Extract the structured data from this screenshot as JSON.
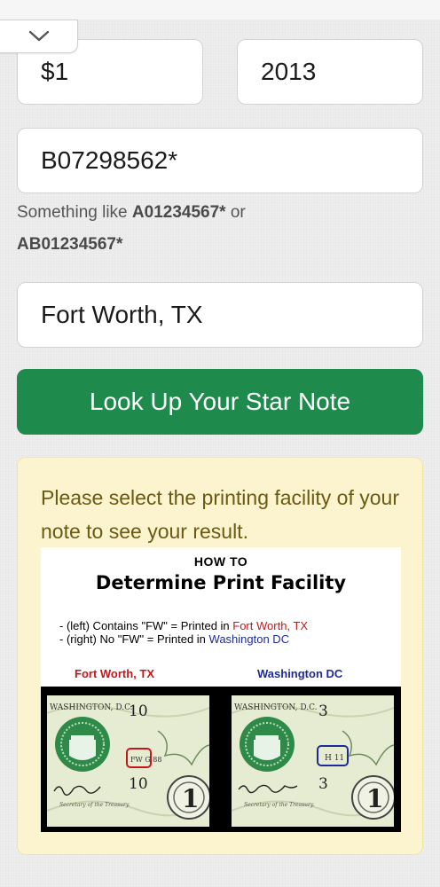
{
  "form": {
    "denomination_value": "$1",
    "year_value": "2013",
    "serial_value": "B07298562*",
    "hint_prefix": "Something like ",
    "hint_example1": "A01234567*",
    "hint_or": " or",
    "hint_example2": "AB01234567*",
    "location_value": "Fort Worth, TX"
  },
  "lookup_button": {
    "label": "Look Up Your Star Note",
    "color": "#1e8a4c"
  },
  "result": {
    "message": "Please select the printing facility of your note to see your result.",
    "infographic": {
      "howto": "HOW TO",
      "title": "Determine Print Facility",
      "line1_prefix": "- (left) Contains \"FW\" = Printed in ",
      "line1_place": "Fort Worth, TX",
      "line2_prefix": "- (right) No \"FW\" = Printed in ",
      "line2_place": "Washington DC",
      "label_left": "Fort Worth, TX",
      "label_right": "Washington DC",
      "note_left": {
        "city": "WASHINGTON, D.C.",
        "number_top": "10",
        "number_bottom": "10",
        "plate": "FW G 88",
        "face": "1",
        "fine_print": "Secretary of the Treasury."
      },
      "note_right": {
        "city": "WASHINGTON, D.C.",
        "number_top": "3",
        "number_bottom": "3",
        "plate": "H 11",
        "face": "1",
        "fine_print": "Secretary of the Treasury."
      }
    }
  },
  "colors": {
    "fort_worth": "#c7161b",
    "washington": "#1f2a9a",
    "result_bg": "#fcf4cf",
    "result_text": "#6b5a12"
  },
  "icons": {
    "collapse": "chevron-down-icon",
    "seal": "treasury-seal-icon"
  }
}
